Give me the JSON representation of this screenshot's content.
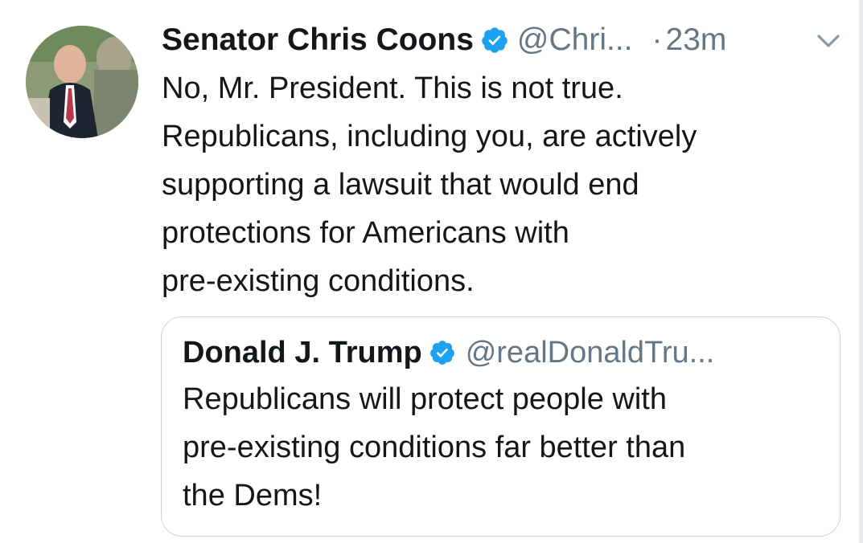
{
  "tweet": {
    "author_name": "Senator Chris Coons",
    "author_handle": "@Chri...",
    "separator": "·",
    "timestamp": "23m",
    "verified_icon": "verified-badge-icon",
    "more_icon": "chevron-down-icon",
    "body_lines": [
      "No, Mr. President. This is not true.",
      "Republicans, including you, are actively",
      "supporting a lawsuit that would end",
      "protections for Americans with",
      "pre-existing conditions."
    ]
  },
  "quoted_tweet": {
    "author_name": "Donald J. Trump",
    "author_handle": "@realDonaldTru...",
    "verified_icon": "verified-badge-icon",
    "body_lines": [
      "Republicans will protect people with",
      "pre-existing conditions far better than",
      "the Dems!"
    ]
  },
  "colors": {
    "text_primary": "#14171a",
    "text_secondary": "#657786",
    "verified_blue": "#1da1f2",
    "border": "#ccd6dd"
  }
}
